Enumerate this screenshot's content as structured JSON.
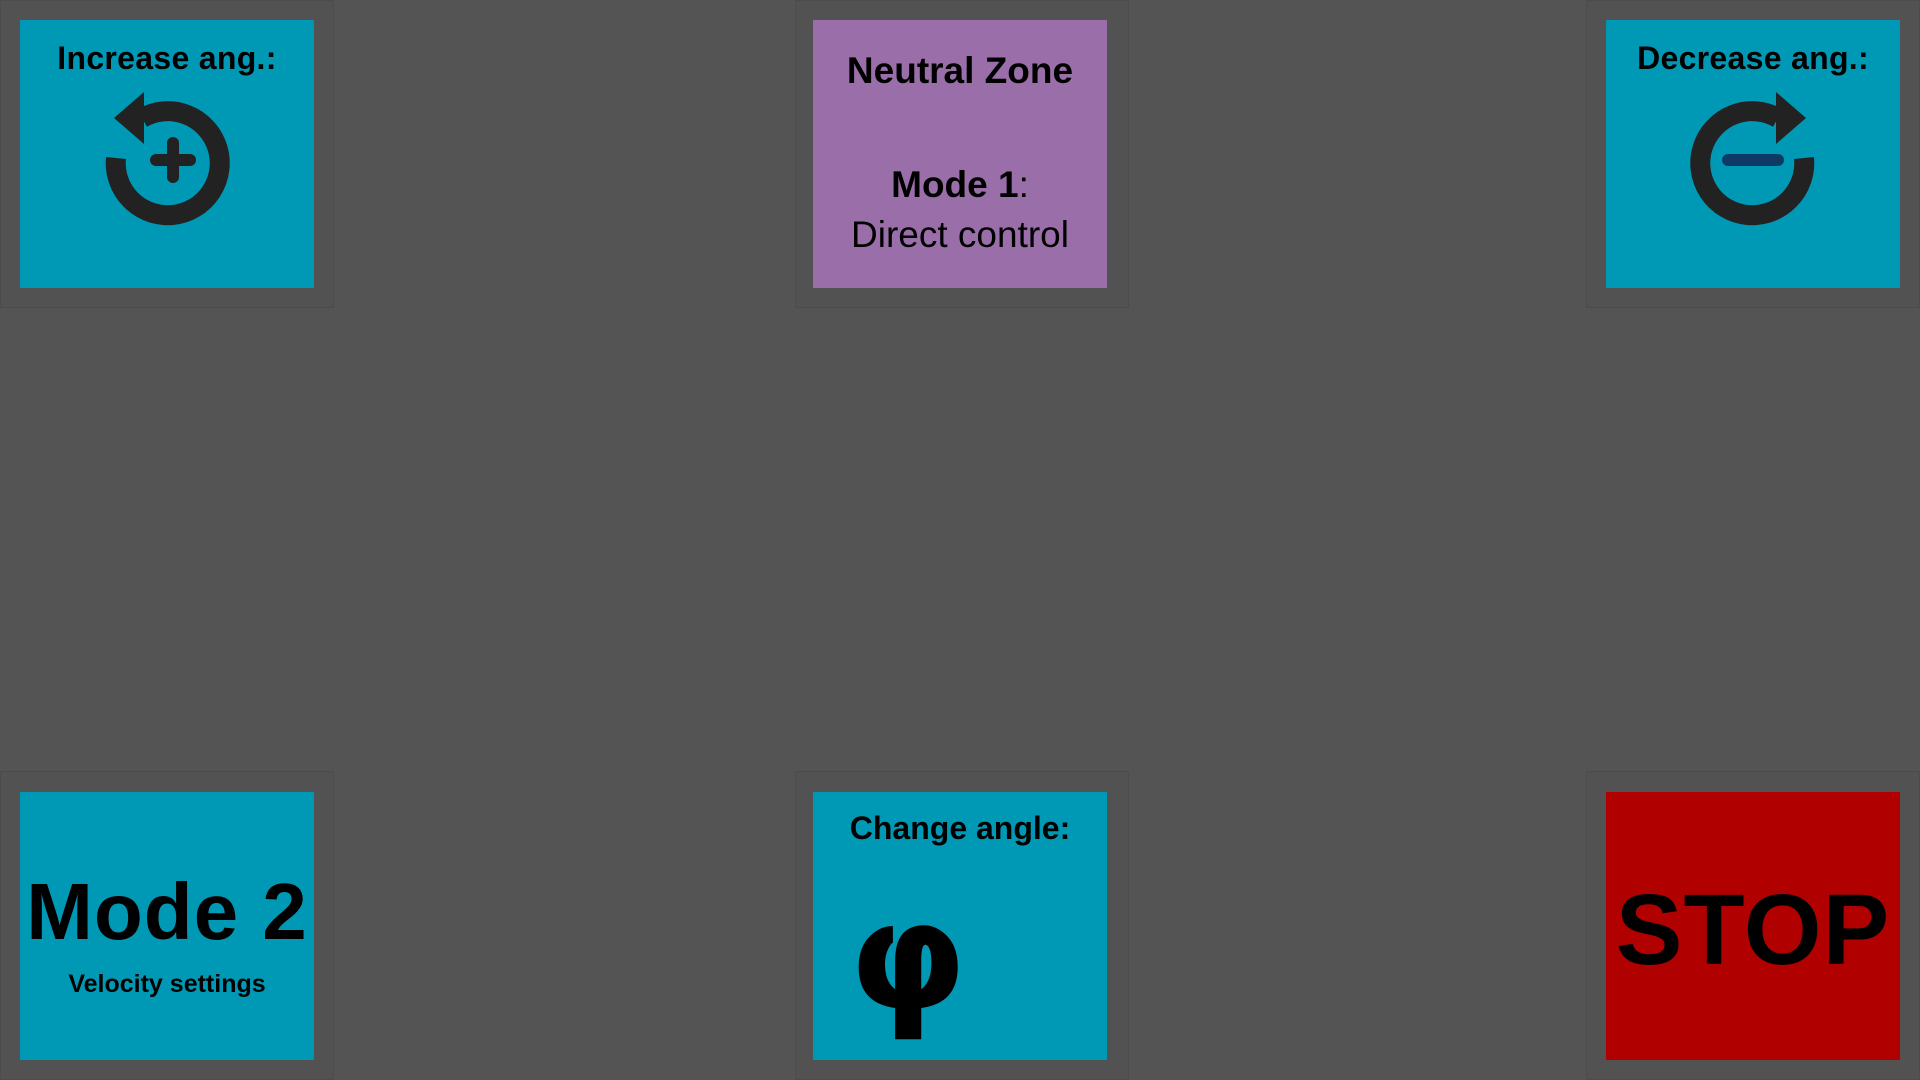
{
  "tiles": {
    "increase_angle": {
      "title": "Increase ang.:",
      "icon": "rotate-ccw-plus-icon",
      "color": "#0099b5"
    },
    "neutral_zone": {
      "title": "Neutral Zone",
      "mode_label": "Mode 1",
      "mode_suffix": ":",
      "mode_description": "Direct control",
      "color": "#9a6ea8"
    },
    "decrease_angle": {
      "title": "Decrease ang.:",
      "icon": "rotate-cw-minus-icon",
      "color": "#0099b5"
    },
    "mode2": {
      "title": "Mode 2",
      "subtitle": "Velocity settings",
      "color": "#0099b5"
    },
    "change_angle": {
      "title": "Change angle:",
      "symbol": "φ",
      "color": "#0099b5"
    },
    "stop": {
      "label": "STOP",
      "color": "#b00000"
    }
  },
  "background": "#545454"
}
